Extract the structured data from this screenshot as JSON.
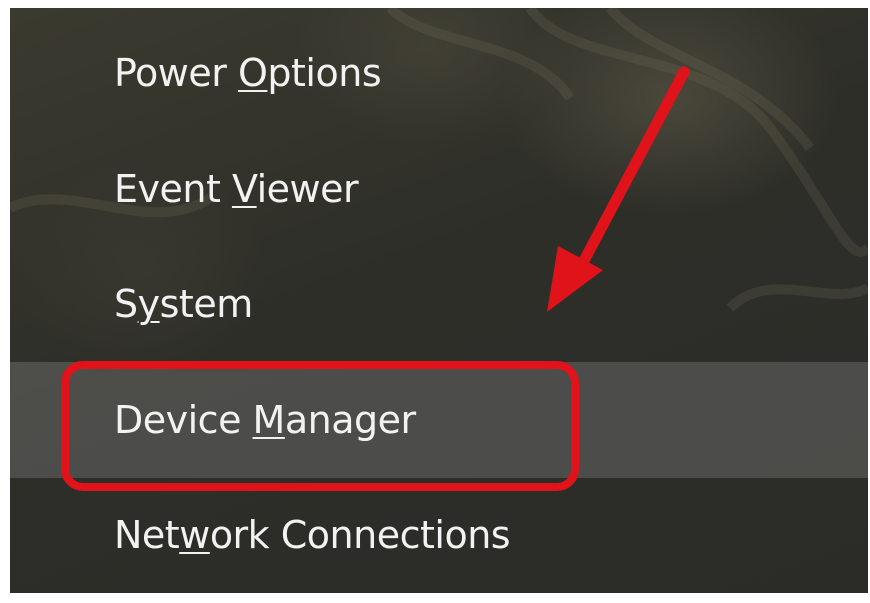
{
  "menu": {
    "items": [
      {
        "before": "Power ",
        "key": "O",
        "after": "ptions",
        "selected": false
      },
      {
        "before": "Event ",
        "key": "V",
        "after": "iewer",
        "selected": false
      },
      {
        "before": "S",
        "key": "y",
        "after": "stem",
        "selected": false
      },
      {
        "before": "Device ",
        "key": "M",
        "after": "anager",
        "selected": true
      },
      {
        "before": "Net",
        "key": "w",
        "after": "ork Connections",
        "selected": false
      }
    ]
  },
  "annotation": {
    "highlight_color": "#e0121a",
    "arrow_color": "#e0121a",
    "target": "Device Manager"
  },
  "colors": {
    "menu_background": "#2e2e29",
    "menu_text": "#f2f2f2",
    "selected_row": "#5a5a57"
  }
}
